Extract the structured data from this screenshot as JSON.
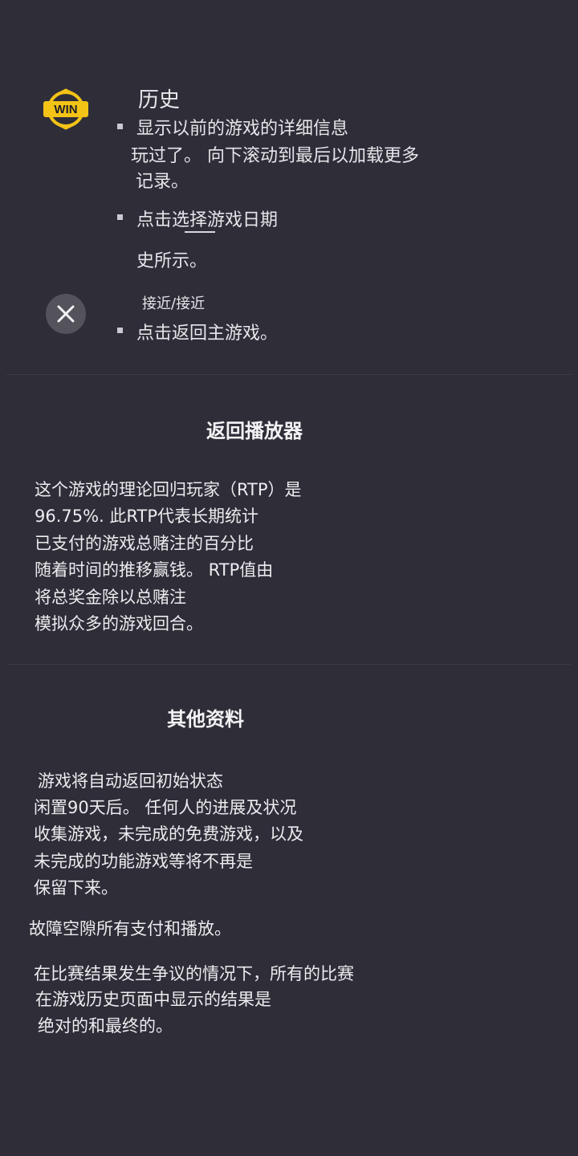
{
  "history": {
    "title": "历史",
    "item1_lines": [
      "显示以前的游戏的详细信息",
      "玩过了。 向下滚动到最后以加载更多",
      "记录。"
    ],
    "item2_lines": [
      "点击选择游戏日期",
      "史所示。"
    ],
    "close_label": "接近/接近",
    "item3_line": "点击返回主游戏。"
  },
  "rtp": {
    "title": "返回播放器",
    "lines": [
      "这个游戏的理论回归玩家（RTP）是",
      "96.75%. 此RTP代表长期统计",
      "已支付的游戏总赌注的百分比",
      "随着时间的推移赢钱。 RTP值由",
      "将总奖金除以总赌注",
      "模拟众多的游戏回合。"
    ]
  },
  "other": {
    "title": "其他资料",
    "para1": [
      "游戏将自动返回初始状态",
      "闲置90天后。 任何人的进展及状况",
      "收集游戏，未完成的免费游戏，以及",
      "未完成的功能游戏等将不再是",
      "保留下来。"
    ],
    "para2": "故障空隙所有支付和播放。",
    "para3": [
      "在比赛结果发生争议的情况下，所有的比赛",
      "在游戏历史页面中显示的结果是",
      "绝对的和最终的。"
    ]
  },
  "icons": {
    "win": "win-badge-icon",
    "close": "close-icon"
  },
  "colors": {
    "background": "#2e2d38",
    "win_gold": "#f3c316",
    "close_bg": "#54535c"
  }
}
